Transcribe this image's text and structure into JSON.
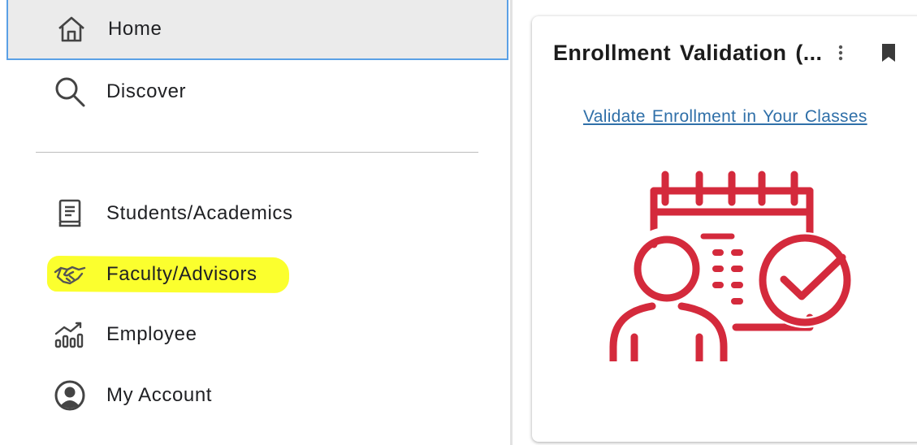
{
  "nav": {
    "items": [
      {
        "id": "home",
        "label": "Home",
        "icon": "home-icon"
      },
      {
        "id": "discover",
        "label": "Discover",
        "icon": "search-icon"
      },
      {
        "id": "students",
        "label": "Students/Academics",
        "icon": "book-icon"
      },
      {
        "id": "faculty",
        "label": "Faculty/Advisors",
        "icon": "handshake-icon"
      },
      {
        "id": "employee",
        "label": "Employee",
        "icon": "chart-icon"
      },
      {
        "id": "account",
        "label": "My Account",
        "icon": "account-circle-icon"
      }
    ],
    "active_item": "Home",
    "highlighted_item": "Faculty/Advisors"
  },
  "card": {
    "title": "Enrollment Validation (...",
    "link": "Validate Enrollment in Your Classes",
    "illustration": "calendar-person-check-icon"
  },
  "colors": {
    "accent_red": "#d42a3c",
    "link_blue": "#2f6fa8",
    "highlight_yellow": "#fbff2e",
    "active_border": "#5aa0e6"
  }
}
